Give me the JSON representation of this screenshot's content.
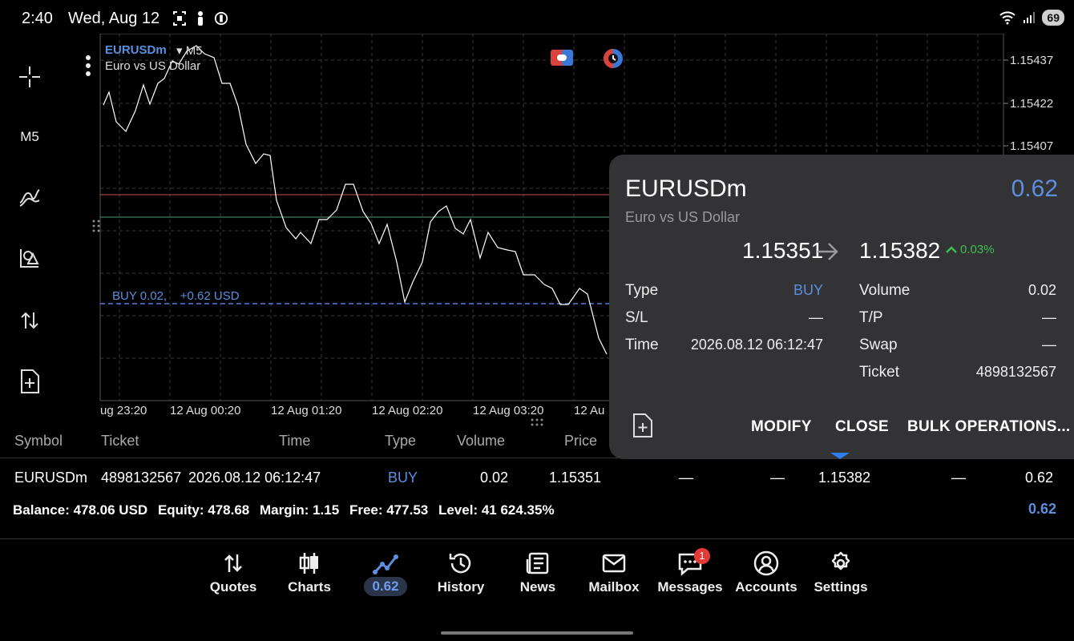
{
  "status_bar": {
    "time": "2:40",
    "date": "Wed, Aug 12",
    "battery": "69"
  },
  "left_toolbar": {
    "timeframe": "M5"
  },
  "chart": {
    "symbol": "EURUSDm",
    "timeframe": "M5",
    "description": "Euro vs US Dollar",
    "y_ticks": [
      "1.15437",
      "1.15422",
      "1.15407"
    ],
    "x_ticks": [
      "ug 23:20",
      "12 Aug 00:20",
      "12 Aug 01:20",
      "12 Aug 02:20",
      "12 Aug 03:20",
      "12 Au"
    ],
    "buy_line_label": "BUY 0.02,    +0.62 USD"
  },
  "popup": {
    "symbol": "EURUSDm",
    "profit": "0.62",
    "description": "Euro vs US Dollar",
    "open_price": "1.15351",
    "current_price": "1.15382",
    "change": "0.03%",
    "fields_left": [
      {
        "label": "Type",
        "value": "BUY"
      },
      {
        "label": "S/L",
        "value": "—"
      },
      {
        "label": "Time",
        "value": "2026.08.12 06:12:47"
      }
    ],
    "fields_right": [
      {
        "label": "Volume",
        "value": "0.02"
      },
      {
        "label": "T/P",
        "value": "—"
      },
      {
        "label": "Swap",
        "value": "—"
      },
      {
        "label": "Ticket",
        "value": "4898132567"
      }
    ],
    "buttons": {
      "modify": "MODIFY",
      "close": "CLOSE",
      "bulk": "BULK OPERATIONS..."
    }
  },
  "table": {
    "headers": [
      "Symbol",
      "Ticket",
      "Time",
      "Type",
      "Volume",
      "Price"
    ],
    "row": {
      "symbol": "EURUSDm",
      "ticket": "4898132567",
      "time": "2026.08.12 06:12:47",
      "type": "BUY",
      "volume": "0.02",
      "price": "1.15351",
      "sl": "—",
      "tp": "—",
      "current": "1.15382",
      "swap": "—",
      "profit": "0.62"
    }
  },
  "summary": {
    "balance": "Balance:  478.06 USD",
    "equity": "Equity:  478.68",
    "margin": "Margin:  1.15",
    "free": "Free:  477.53",
    "level": "Level:  41 624.35%",
    "profit": "0.62"
  },
  "nav": {
    "quotes": "Quotes",
    "charts": "Charts",
    "trade": "0.62",
    "history": "History",
    "news": "News",
    "mailbox": "Mailbox",
    "messages": "Messages",
    "messages_badge": "1",
    "accounts": "Accounts",
    "settings": "Settings"
  }
}
